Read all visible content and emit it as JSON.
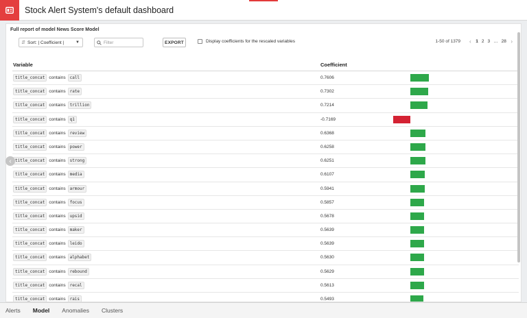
{
  "header": {
    "title": "Stock Alert System's default dashboard",
    "icon": "dashboard-icon",
    "accent_color": "#e43f3f"
  },
  "report": {
    "title": "Full report of model News Score Model",
    "sort_label": "Sort: | Coefficient |",
    "filter_placeholder": "Filter",
    "export_label": "EXPORT",
    "rescale_label": "Display coefficients for the rescaled variables",
    "rescale_checked": false
  },
  "pagination": {
    "range": "1-50 of 1379",
    "pages": [
      "1",
      "2",
      "3",
      "…",
      "28"
    ],
    "current": "1"
  },
  "table": {
    "columns": [
      "Variable",
      "Coefficient"
    ],
    "positive_color": "#2ea84a",
    "negative_color": "#d42233",
    "rows": [
      {
        "feature": "title_concat",
        "op": "contains",
        "token": "call",
        "coefficient": "0.7606",
        "value": 0.7606
      },
      {
        "feature": "title_concat",
        "op": "contains",
        "token": "rate",
        "coefficient": "0.7302",
        "value": 0.7302
      },
      {
        "feature": "title_concat",
        "op": "contains",
        "token": "trillion",
        "coefficient": "0.7214",
        "value": 0.7214
      },
      {
        "feature": "title_concat",
        "op": "contains",
        "token": "q1",
        "coefficient": "-0.7169",
        "value": -0.7169
      },
      {
        "feature": "title_concat",
        "op": "contains",
        "token": "review",
        "coefficient": "0.6368",
        "value": 0.6368
      },
      {
        "feature": "title_concat",
        "op": "contains",
        "token": "power",
        "coefficient": "0.6258",
        "value": 0.6258
      },
      {
        "feature": "title_concat",
        "op": "contains",
        "token": "strong",
        "coefficient": "0.6251",
        "value": 0.6251
      },
      {
        "feature": "title_concat",
        "op": "contains",
        "token": "media",
        "coefficient": "0.6107",
        "value": 0.6107
      },
      {
        "feature": "title_concat",
        "op": "contains",
        "token": "armour",
        "coefficient": "0.5941",
        "value": 0.5941
      },
      {
        "feature": "title_concat",
        "op": "contains",
        "token": "focus",
        "coefficient": "0.5857",
        "value": 0.5857
      },
      {
        "feature": "title_concat",
        "op": "contains",
        "token": "upsid",
        "coefficient": "0.5678",
        "value": 0.5678
      },
      {
        "feature": "title_concat",
        "op": "contains",
        "token": "maker",
        "coefficient": "0.5639",
        "value": 0.5639
      },
      {
        "feature": "title_concat",
        "op": "contains",
        "token": "leido",
        "coefficient": "0.5639",
        "value": 0.5639
      },
      {
        "feature": "title_concat",
        "op": "contains",
        "token": "alphabet",
        "coefficient": "0.5630",
        "value": 0.563
      },
      {
        "feature": "title_concat",
        "op": "contains",
        "token": "rebound",
        "coefficient": "0.5629",
        "value": 0.5629
      },
      {
        "feature": "title_concat",
        "op": "contains",
        "token": "recal",
        "coefficient": "0.5613",
        "value": 0.5613
      },
      {
        "feature": "title_concat",
        "op": "contains",
        "token": "rais",
        "coefficient": "0.5493",
        "value": 0.5493
      }
    ]
  },
  "tabs": [
    {
      "label": "Alerts",
      "active": false
    },
    {
      "label": "Model",
      "active": true
    },
    {
      "label": "Anomalies",
      "active": false
    },
    {
      "label": "Clusters",
      "active": false
    }
  ]
}
